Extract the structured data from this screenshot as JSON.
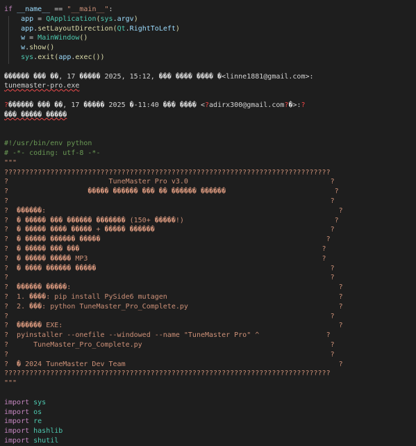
{
  "colors": {
    "background": "#1e1e1e",
    "keyword": "#c586c0",
    "keyword_blue": "#569cd6",
    "variable": "#9cdcfe",
    "string": "#ce9178",
    "function": "#dcdcaa",
    "class": "#4ec9b0",
    "text": "#d4d4d4",
    "comment": "#6a9955",
    "error": "#f44747"
  },
  "lines": [
    [
      {
        "t": "if ",
        "c": "kw"
      },
      {
        "t": "__name__",
        "c": "var"
      },
      {
        "t": " == ",
        "c": "txt"
      },
      {
        "t": "\"__main__\"",
        "c": "str"
      },
      {
        "t": ":",
        "c": "txt"
      }
    ],
    [
      {
        "t": "    app",
        "c": "var"
      },
      {
        "t": " = ",
        "c": "txt"
      },
      {
        "t": "QApplication",
        "c": "cls"
      },
      {
        "t": "(",
        "c": "fn"
      },
      {
        "t": "sys",
        "c": "cls"
      },
      {
        "t": ".",
        "c": "txt"
      },
      {
        "t": "argv",
        "c": "var"
      },
      {
        "t": ")",
        "c": "fn"
      }
    ],
    [
      {
        "t": "    app",
        "c": "var"
      },
      {
        "t": ".",
        "c": "txt"
      },
      {
        "t": "setLayoutDirection",
        "c": "fn"
      },
      {
        "t": "(",
        "c": "fn"
      },
      {
        "t": "Qt",
        "c": "cls"
      },
      {
        "t": ".",
        "c": "txt"
      },
      {
        "t": "RightToLeft",
        "c": "var"
      },
      {
        "t": ")",
        "c": "fn"
      }
    ],
    [
      {
        "t": "    w",
        "c": "var"
      },
      {
        "t": " = ",
        "c": "txt"
      },
      {
        "t": "MainWindow",
        "c": "cls"
      },
      {
        "t": "()",
        "c": "fn"
      }
    ],
    [
      {
        "t": "    w",
        "c": "var"
      },
      {
        "t": ".",
        "c": "txt"
      },
      {
        "t": "show",
        "c": "fn"
      },
      {
        "t": "()",
        "c": "fn"
      }
    ],
    [
      {
        "t": "    sys",
        "c": "cls"
      },
      {
        "t": ".",
        "c": "txt"
      },
      {
        "t": "exit",
        "c": "fn"
      },
      {
        "t": "(",
        "c": "fn"
      },
      {
        "t": "app",
        "c": "var"
      },
      {
        "t": ".",
        "c": "txt"
      },
      {
        "t": "exec",
        "c": "fn"
      },
      {
        "t": "()",
        "c": "fn"
      },
      {
        "t": ")",
        "c": "fn"
      }
    ],
    [],
    [
      {
        "t": "������ ��� ��, 17 ����� 2025, 15:12, ��� ���� ���� �<linne1881@gmail.com>:",
        "c": "txt"
      }
    ],
    [
      {
        "t": "tunemaster-pro.exe",
        "c": "txt",
        "u": true
      }
    ],
    [],
    [
      {
        "t": "?",
        "c": "err"
      },
      {
        "t": "������ ��� ��, 17 ����� 2025 �-11:40 ��� ���� <",
        "c": "txt"
      },
      {
        "t": "?",
        "c": "err"
      },
      {
        "t": "adirx300@gmail.com",
        "c": "txt"
      },
      {
        "t": "?",
        "c": "err"
      },
      {
        "t": "�>:",
        "c": "txt"
      },
      {
        "t": "?",
        "c": "err"
      }
    ],
    [
      {
        "t": "��� ����� �����",
        "c": "txt",
        "u": true
      }
    ],
    [],
    [],
    [
      {
        "t": "#!/usr/bin/env python",
        "c": "cm"
      }
    ],
    [
      {
        "t": "# -*- coding: utf-8 -*-",
        "c": "cm"
      }
    ],
    [
      {
        "t": "\"\"\"",
        "c": "str"
      }
    ],
    [
      {
        "t": "??????????????????????????????????????????????????????????????????????????????",
        "c": "str"
      }
    ],
    [
      {
        "t": "?                        TuneMaster Pro v3.0                                  ?",
        "c": "str"
      }
    ],
    [
      {
        "t": "?                   ����� ������ ��� �� ������ ������                          ?",
        "c": "str"
      }
    ],
    [
      {
        "t": "?                                                                             ?",
        "c": "str"
      }
    ],
    [
      {
        "t": "?  ������:                                                                      ?",
        "c": "str"
      }
    ],
    [
      {
        "t": "?  � ����� ��� ������ ������� (150+ �����!)                                    ?",
        "c": "str"
      }
    ],
    [
      {
        "t": "?  � ����� ���� ����� + ����� ������                                          ?",
        "c": "str"
      }
    ],
    [
      {
        "t": "?  � ����� ������ �����                                                      ?",
        "c": "str"
      }
    ],
    [
      {
        "t": "?  � ����� ��� ���                                                          ?",
        "c": "str"
      }
    ],
    [
      {
        "t": "?  � ����� ����� MP3                                                        ?",
        "c": "str"
      }
    ],
    [
      {
        "t": "?  � ���� ������ �����                                                        ?",
        "c": "str"
      }
    ],
    [
      {
        "t": "?                                                                             ?",
        "c": "str"
      }
    ],
    [
      {
        "t": "?  ������ �����:                                                                ?",
        "c": "str"
      }
    ],
    [
      {
        "t": "?  1. ����: pip install PySide6 mutagen                                         ?",
        "c": "str"
      }
    ],
    [
      {
        "t": "?  2. ���: python TuneMaster_Pro_Complete.py                                    ?",
        "c": "str"
      }
    ],
    [
      {
        "t": "?                                                                             ?",
        "c": "str"
      }
    ],
    [
      {
        "t": "?  ������ EXE:                                                                  ?",
        "c": "str"
      }
    ],
    [
      {
        "t": "?  pyinstaller --onefile --windowed --name \"TuneMaster Pro\" ^                ?",
        "c": "str"
      }
    ],
    [
      {
        "t": "?      TuneMaster_Pro_Complete.py                                             ?",
        "c": "str"
      }
    ],
    [
      {
        "t": "?                                                                             ?",
        "c": "str"
      }
    ],
    [
      {
        "t": "?  � 2024 TuneMaster Dev Team                                                   ?",
        "c": "str"
      }
    ],
    [
      {
        "t": "??????????????????????????????????????????????????????????????????????????????",
        "c": "str"
      }
    ],
    [
      {
        "t": "\"\"\"",
        "c": "str"
      }
    ],
    [],
    [
      {
        "t": "import",
        "c": "kw"
      },
      {
        "t": " sys",
        "c": "cls"
      }
    ],
    [
      {
        "t": "import",
        "c": "kw"
      },
      {
        "t": " os",
        "c": "cls"
      }
    ],
    [
      {
        "t": "import",
        "c": "kw"
      },
      {
        "t": " re",
        "c": "cls"
      }
    ],
    [
      {
        "t": "import",
        "c": "kw"
      },
      {
        "t": " hashlib",
        "c": "cls"
      }
    ],
    [
      {
        "t": "import",
        "c": "kw"
      },
      {
        "t": " shutil",
        "c": "cls"
      }
    ]
  ]
}
